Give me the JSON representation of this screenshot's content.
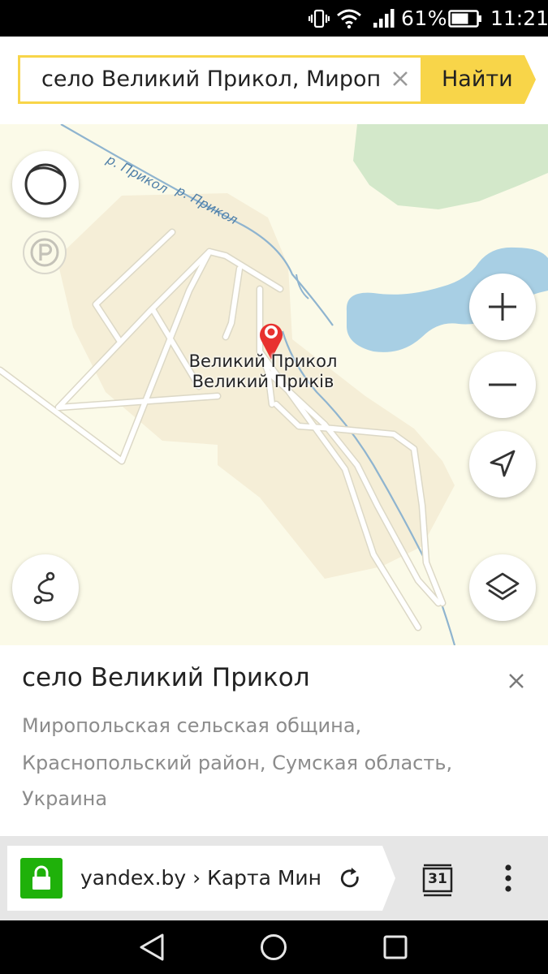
{
  "status_bar": {
    "battery_percent": "61%",
    "time": "11:21"
  },
  "search": {
    "query": "село Великий Прикол, Мироп",
    "find_label": "Найти"
  },
  "map": {
    "river_labels": [
      "р. Прикол",
      "р. Прикол"
    ],
    "place_label_ru": "Великий Прикол",
    "place_label_uk": "Великий Приків",
    "icons": {
      "compass": "compass-icon",
      "parking": "parking-icon",
      "zoom_in": "plus-icon",
      "zoom_out": "minus-icon",
      "locate": "navigation-arrow-icon",
      "route": "route-icon",
      "layers": "layers-icon"
    },
    "colors": {
      "background": "#fbfae8",
      "settlement": "#f5eed7",
      "water": "#a8cfe4",
      "forest": "#d3e8ca",
      "road": "#ffffff",
      "pin": "#e8322f"
    }
  },
  "card": {
    "title": "село Великий Прикол",
    "address_lines": [
      "Миропольская сельская община,",
      "Краснопольский район, Сумская область,",
      "Украина"
    ]
  },
  "browser": {
    "url": "yandex.by › Карта Минск",
    "tabs_count": "31",
    "lock_color": "#1fb10a"
  }
}
